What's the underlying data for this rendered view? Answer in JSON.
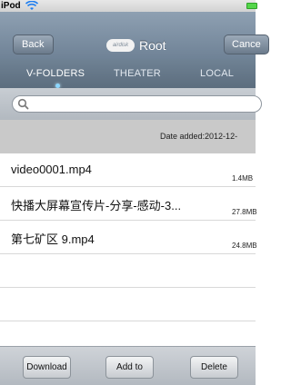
{
  "status": {
    "carrier": "iPod"
  },
  "nav": {
    "back_label": "Back",
    "logo_text": "airdisk",
    "title": "Root",
    "cancel_label": "Cance"
  },
  "tabs": [
    {
      "label": "V-FOLDERS",
      "active": true
    },
    {
      "label": "THEATER",
      "active": false
    },
    {
      "label": "LOCAL",
      "active": false
    }
  ],
  "search": {
    "placeholder": ""
  },
  "sort_header": {
    "text": "Date added:2012-12-"
  },
  "files": [
    {
      "name": "video0001.mp4",
      "size": "1.4MB"
    },
    {
      "name": "快播大屏幕宣传片-分享-感动-3...",
      "size": "27.8MB"
    },
    {
      "name": "第七矿区 9.mp4",
      "size": "24.8MB"
    }
  ],
  "toolbar": {
    "download_label": "Download",
    "add_label": "Add to",
    "delete_label": "Delete"
  },
  "colors": {
    "nav": "#7d8fa2",
    "tab_indicator": "#8dd7ff",
    "battery": "#54d64a"
  },
  "icons": {
    "wifi": "wifi-icon",
    "battery": "battery-icon",
    "search": "search-icon"
  }
}
